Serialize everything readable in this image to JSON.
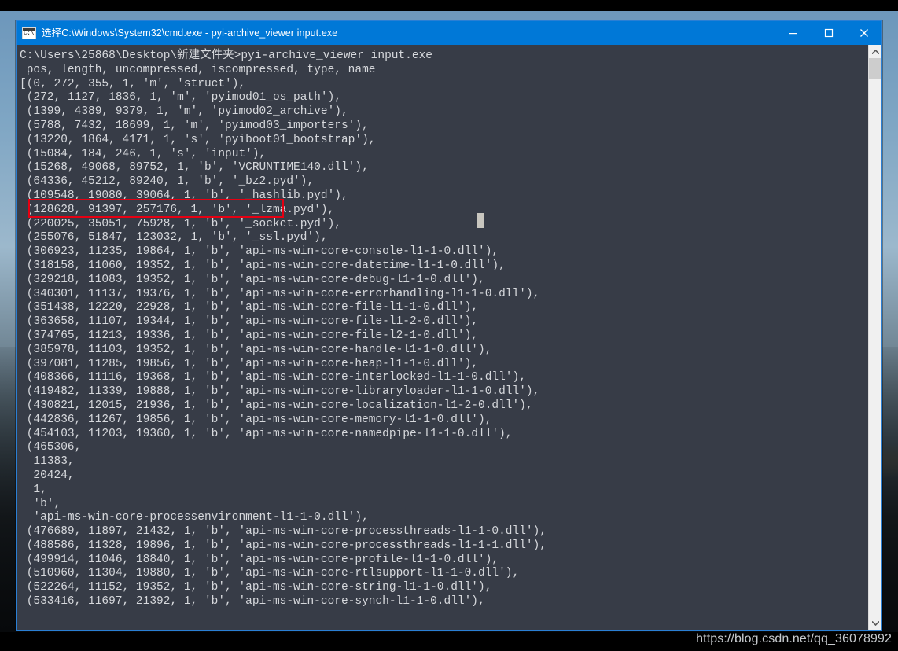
{
  "window": {
    "title": "选择C:\\Windows\\System32\\cmd.exe - pyi-archive_viewer  input.exe",
    "icon": "cmd-console-icon",
    "accent_color": "#0078d7",
    "console_bg": "#373c47",
    "console_fg": "#d6d8dc",
    "border_color": "#2a7fd4",
    "buttons": {
      "minimize": "minimize-button",
      "maximize": "maximize-button",
      "close": "close-button"
    }
  },
  "scrollbar": {
    "up_arrow": "scroll-up-arrow",
    "down_arrow": "scroll-down-arrow",
    "thumb": "scroll-thumb"
  },
  "annotation": {
    "highlight_color": "#e60012",
    "highlighted_line": "(15084, 184, 246, 1, 's', 'input'),"
  },
  "watermark": {
    "text": "https://blog.csdn.net/qq_36078992"
  },
  "console": {
    "prompt": "C:\\Users\\25868\\Desktop\\新建文件夹>",
    "command": "pyi-archive_viewer input.exe",
    "header": " pos, length, uncompressed, iscompressed, type, name",
    "lines": [
      "C:\\Users\\25868\\Desktop\\新建文件夹>pyi-archive_viewer input.exe",
      " pos, length, uncompressed, iscompressed, type, name",
      "[(0, 272, 355, 1, 'm', 'struct'),",
      " (272, 1127, 1836, 1, 'm', 'pyimod01_os_path'),",
      " (1399, 4389, 9379, 1, 'm', 'pyimod02_archive'),",
      " (5788, 7432, 18699, 1, 'm', 'pyimod03_importers'),",
      " (13220, 1864, 4171, 1, 's', 'pyiboot01_bootstrap'),",
      " (15084, 184, 246, 1, 's', 'input'),",
      " (15268, 49068, 89752, 1, 'b', 'VCRUNTIME140.dll'),",
      " (64336, 45212, 89240, 1, 'b', '_bz2.pyd'),",
      " (109548, 19080, 39064, 1, 'b', '_hashlib.pyd'),",
      " (128628, 91397, 257176, 1, 'b', '_lzma.pyd'),",
      " (220025, 35051, 75928, 1, 'b', '_socket.pyd'),",
      " (255076, 51847, 123032, 1, 'b', '_ssl.pyd'),",
      " (306923, 11235, 19864, 1, 'b', 'api-ms-win-core-console-l1-1-0.dll'),",
      " (318158, 11060, 19352, 1, 'b', 'api-ms-win-core-datetime-l1-1-0.dll'),",
      " (329218, 11083, 19352, 1, 'b', 'api-ms-win-core-debug-l1-1-0.dll'),",
      " (340301, 11137, 19376, 1, 'b', 'api-ms-win-core-errorhandling-l1-1-0.dll'),",
      " (351438, 12220, 22928, 1, 'b', 'api-ms-win-core-file-l1-1-0.dll'),",
      " (363658, 11107, 19344, 1, 'b', 'api-ms-win-core-file-l1-2-0.dll'),",
      " (374765, 11213, 19336, 1, 'b', 'api-ms-win-core-file-l2-1-0.dll'),",
      " (385978, 11103, 19352, 1, 'b', 'api-ms-win-core-handle-l1-1-0.dll'),",
      " (397081, 11285, 19856, 1, 'b', 'api-ms-win-core-heap-l1-1-0.dll'),",
      " (408366, 11116, 19368, 1, 'b', 'api-ms-win-core-interlocked-l1-1-0.dll'),",
      " (419482, 11339, 19888, 1, 'b', 'api-ms-win-core-libraryloader-l1-1-0.dll'),",
      " (430821, 12015, 21936, 1, 'b', 'api-ms-win-core-localization-l1-2-0.dll'),",
      " (442836, 11267, 19856, 1, 'b', 'api-ms-win-core-memory-l1-1-0.dll'),",
      " (454103, 11203, 19360, 1, 'b', 'api-ms-win-core-namedpipe-l1-1-0.dll'),",
      " (465306,",
      "  11383,",
      "  20424,",
      "  1,",
      "  'b',",
      "  'api-ms-win-core-processenvironment-l1-1-0.dll'),",
      " (476689, 11897, 21432, 1, 'b', 'api-ms-win-core-processthreads-l1-1-0.dll'),",
      " (488586, 11328, 19896, 1, 'b', 'api-ms-win-core-processthreads-l1-1-1.dll'),",
      " (499914, 11046, 18840, 1, 'b', 'api-ms-win-core-profile-l1-1-0.dll'),",
      " (510960, 11304, 19880, 1, 'b', 'api-ms-win-core-rtlsupport-l1-1-0.dll'),",
      " (522264, 11152, 19352, 1, 'b', 'api-ms-win-core-string-l1-1-0.dll'),",
      " (533416, 11697, 21392, 1, 'b', 'api-ms-win-core-synch-l1-1-0.dll'),"
    ]
  }
}
